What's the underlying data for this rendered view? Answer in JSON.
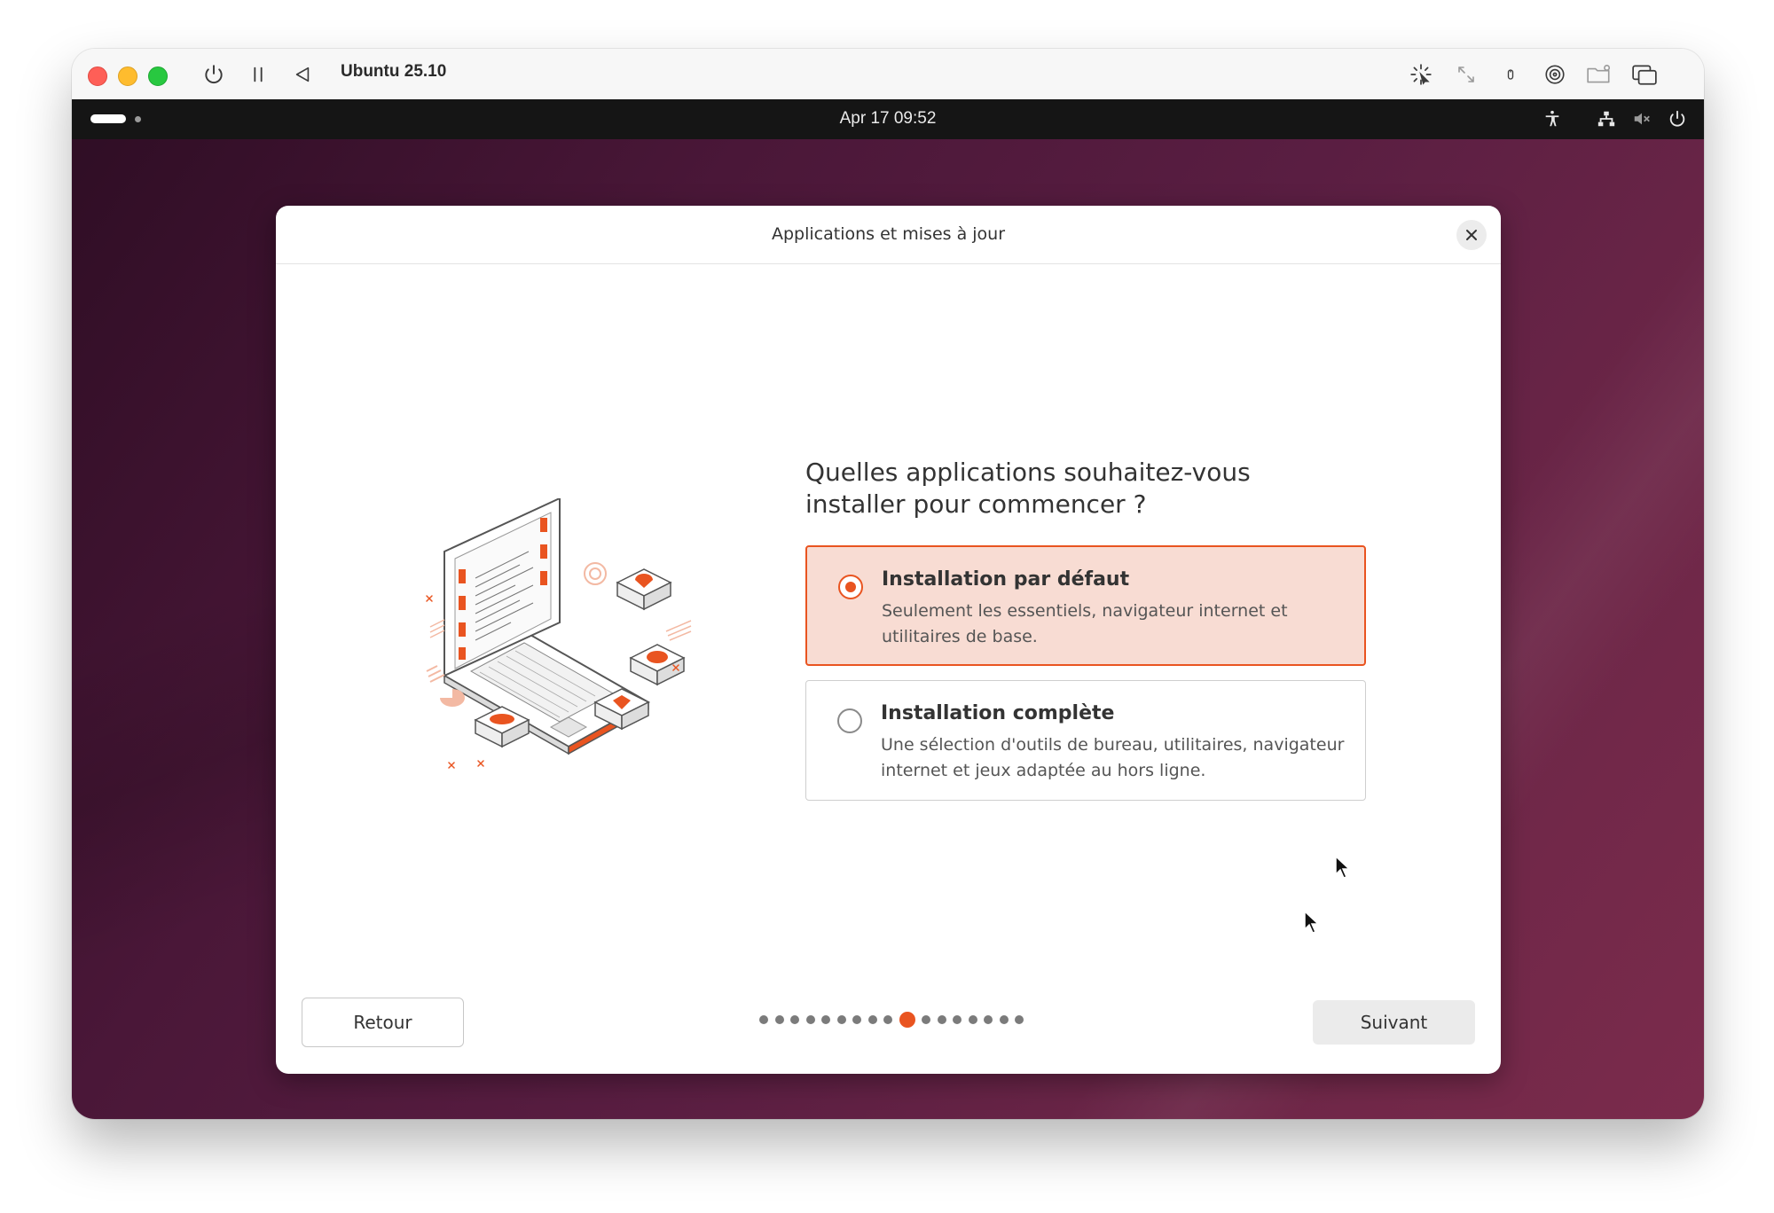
{
  "vm_window": {
    "title": "Ubuntu 25.10"
  },
  "topbar": {
    "clock": "Apr 17  09:52"
  },
  "dialog": {
    "title": "Applications et mises à jour",
    "question": "Quelles applications souhaitez-vous installer pour commencer ?",
    "options": [
      {
        "title": "Installation par défaut",
        "description": "Seulement les essentiels, navigateur internet et utilitaires de base.",
        "selected": true
      },
      {
        "title": "Installation complète",
        "description": "Une sélection d'outils de bureau, utilitaires, navigateur internet et jeux adaptée au hors ligne.",
        "selected": false
      }
    ],
    "back_label": "Retour",
    "next_label": "Suivant",
    "progress": {
      "total": 17,
      "current": 10
    }
  },
  "colors": {
    "accent": "#e95420",
    "selected_bg": "#f8dcd3"
  },
  "icons": [
    "power-icon",
    "pause-icon",
    "back-triangle-icon",
    "cursor-capture-icon",
    "resize-icon",
    "usb-icon",
    "disc-icon",
    "shared-folder-icon",
    "windows-icon",
    "accessibility-icon",
    "network-icon",
    "volume-muted-icon",
    "system-power-icon",
    "close-icon",
    "mouse-pointer-icon"
  ]
}
